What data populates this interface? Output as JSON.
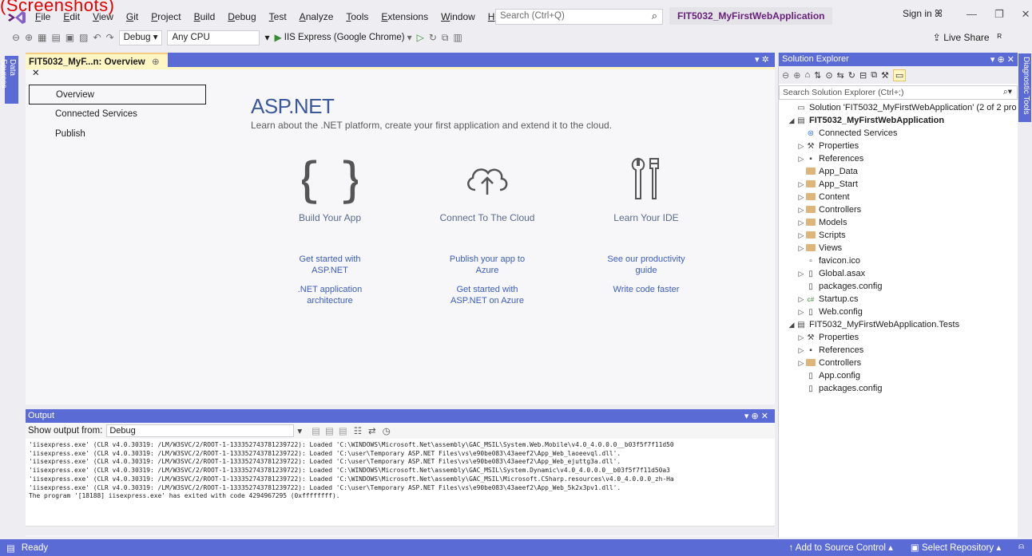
{
  "overlay_text": "(Screenshots)",
  "menu": [
    "File",
    "Edit",
    "View",
    "Git",
    "Project",
    "Build",
    "Debug",
    "Test",
    "Analyze",
    "Tools",
    "Extensions",
    "Window",
    "Help"
  ],
  "search": {
    "placeholder": "Search (Ctrl+Q)"
  },
  "solution_title": "FIT5032_MyFirstWebApplication",
  "signin": "Sign in",
  "toolbar": {
    "config": "Debug",
    "platform": "Any CPU",
    "run": "IIS Express (Google Chrome)",
    "liveshare": "Live Share"
  },
  "side": {
    "left": "Data Sources",
    "right": "Diagnostic Tools"
  },
  "doc_tab": {
    "title": "FIT5032_MyF...n: Overview"
  },
  "nav": [
    "Overview",
    "Connected Services",
    "Publish"
  ],
  "aspnet": {
    "logo": "ASP.NET",
    "subtitle": "Learn about the .NET platform, create your first application and extend it to the cloud."
  },
  "cards": [
    {
      "title": "Build Your App",
      "link1": "Get started with\nASP.NET",
      "link2": ".NET application\narchitecture"
    },
    {
      "title": "Connect To The Cloud",
      "link1": "Publish your app to\nAzure",
      "link2": "Get started with\nASP.NET on Azure"
    },
    {
      "title": "Learn Your IDE",
      "link1": "See our productivity\nguide",
      "link2": "Write code faster"
    }
  ],
  "output": {
    "title": "Output",
    "show_label": "Show output from:",
    "source": "Debug",
    "lines": [
      "'iisexpress.exe' (CLR v4.0.30319: /LM/W3SVC/2/ROOT-1-133352743781239722): Loaded 'C:\\WINDOWS\\Microsoft.Net\\assembly\\GAC_MSIL\\System.Web.Mobile\\v4.0_4.0.0.0__b03f5f7f11d50",
      "'iisexpress.exe' (CLR v4.0.30319: /LM/W3SVC/2/ROOT-1-133352743781239722): Loaded 'C:\\user\\Temporary ASP.NET Files\\vs\\e90be083\\43aeef2\\App_Web_laoeevql.dll'.",
      "'iisexpress.exe' (CLR v4.0.30319: /LM/W3SVC/2/ROOT-1-133352743781239722): Loaded 'C:\\user\\Temporary ASP.NET Files\\vs\\e90be083\\43aeef2\\App_Web_ejuttg3a.dll'.",
      "'iisexpress.exe' (CLR v4.0.30319: /LM/W3SVC/2/ROOT-1-133352743781239722): Loaded 'C:\\WINDOWS\\Microsoft.Net\\assembly\\GAC_MSIL\\System.Dynamic\\v4.0_4.0.0.0__b03f5f7f11d50a3",
      "'iisexpress.exe' (CLR v4.0.30319: /LM/W3SVC/2/ROOT-1-133352743781239722): Loaded 'C:\\WINDOWS\\Microsoft.Net\\assembly\\GAC_MSIL\\Microsoft.CSharp.resources\\v4.0_4.0.0.0_zh-Ha",
      "'iisexpress.exe' (CLR v4.0.30319: /LM/W3SVC/2/ROOT-1-133352743781239722): Loaded 'C:\\user\\Temporary ASP.NET Files\\vs\\e90be083\\43aeef2\\App_Web_5k2x3pv1.dll'.",
      "The program '[18188] iisexpress.exe' has exited with code 4294967295 (0xffffffff)."
    ]
  },
  "solution_explorer": {
    "title": "Solution Explorer",
    "search_placeholder": "Search Solution Explorer (Ctrl+;)",
    "items": [
      {
        "label": "Solution 'FIT5032_MyFirstWebApplication' (2 of 2 pro",
        "level": 0,
        "tw": "",
        "icon": "solution-icon",
        "bold": false
      },
      {
        "label": "FIT5032_MyFirstWebApplication",
        "level": 0,
        "tw": "◢",
        "icon": "project-icon",
        "bold": true
      },
      {
        "label": "Connected Services",
        "level": 1,
        "tw": "",
        "icon": "connected-services-icon",
        "bold": false
      },
      {
        "label": "Properties",
        "level": 1,
        "tw": "▷",
        "icon": "wrench-icon",
        "bold": false
      },
      {
        "label": "References",
        "level": 1,
        "tw": "▷",
        "icon": "references-icon",
        "bold": false
      },
      {
        "label": "App_Data",
        "level": 1,
        "tw": "",
        "icon": "folder-icon",
        "bold": false
      },
      {
        "label": "App_Start",
        "level": 1,
        "tw": "▷",
        "icon": "folder-icon",
        "bold": false
      },
      {
        "label": "Content",
        "level": 1,
        "tw": "▷",
        "icon": "folder-icon",
        "bold": false
      },
      {
        "label": "Controllers",
        "level": 1,
        "tw": "▷",
        "icon": "folder-icon",
        "bold": false
      },
      {
        "label": "Models",
        "level": 1,
        "tw": "▷",
        "icon": "folder-icon",
        "bold": false
      },
      {
        "label": "Scripts",
        "level": 1,
        "tw": "▷",
        "icon": "folder-icon",
        "bold": false
      },
      {
        "label": "Views",
        "level": 1,
        "tw": "▷",
        "icon": "folder-icon",
        "bold": false
      },
      {
        "label": "favicon.ico",
        "level": 1,
        "tw": "",
        "icon": "image-file-icon",
        "bold": false
      },
      {
        "label": "Global.asax",
        "level": 1,
        "tw": "▷",
        "icon": "file-icon",
        "bold": false
      },
      {
        "label": "packages.config",
        "level": 1,
        "tw": "",
        "icon": "config-file-icon",
        "bold": false
      },
      {
        "label": "Startup.cs",
        "level": 1,
        "tw": "▷",
        "icon": "csharp-file-icon",
        "bold": false
      },
      {
        "label": "Web.config",
        "level": 1,
        "tw": "▷",
        "icon": "config-file-icon",
        "bold": false
      },
      {
        "label": "FIT5032_MyFirstWebApplication.Tests",
        "level": 0,
        "tw": "◢",
        "icon": "test-project-icon",
        "bold": false
      },
      {
        "label": "Properties",
        "level": 1,
        "tw": "▷",
        "icon": "wrench-icon",
        "bold": false
      },
      {
        "label": "References",
        "level": 1,
        "tw": "▷",
        "icon": "references-icon",
        "bold": false
      },
      {
        "label": "Controllers",
        "level": 1,
        "tw": "▷",
        "icon": "folder-icon",
        "bold": false
      },
      {
        "label": "App.config",
        "level": 1,
        "tw": "",
        "icon": "config-file-icon",
        "bold": false
      },
      {
        "label": "packages.config",
        "level": 1,
        "tw": "",
        "icon": "config-file-icon",
        "bold": false
      }
    ]
  },
  "status": {
    "ready": "Ready",
    "source_control": "Add to Source Control",
    "repository": "Select Repository"
  },
  "colors": {
    "accent": "#5b6bd6",
    "link": "#3a5dbd",
    "tab_active": "#fff6c4",
    "vs_purple": "#68217a"
  }
}
